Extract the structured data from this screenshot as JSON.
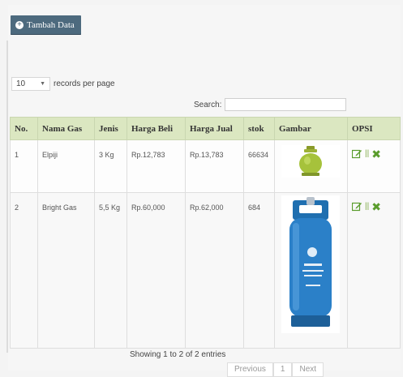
{
  "toolbar": {
    "add_label": "Tambah Data"
  },
  "length": {
    "value": "10",
    "suffix": "records per page"
  },
  "search": {
    "label": "Search:"
  },
  "table": {
    "headers": [
      "No.",
      "Nama Gas",
      "Jenis",
      "Harga Beli",
      "Harga Jual",
      "stok",
      "Gambar",
      "OPSI"
    ],
    "rows": [
      {
        "no": "1",
        "nama": "Elpiji",
        "jenis": "3 Kg",
        "beli": "Rp.12,783",
        "jual": "Rp.13,783",
        "stok": "66634"
      },
      {
        "no": "2",
        "nama": "Bright Gas",
        "jenis": "5,5 Kg",
        "beli": "Rp.60,000",
        "jual": "Rp.62,000",
        "stok": "684"
      }
    ],
    "opsi_separator": "||"
  },
  "footer": {
    "info": "Showing 1 to 2 of 2 entries"
  },
  "pagination": {
    "previous": "Previous",
    "page": "1",
    "next": "Next"
  }
}
